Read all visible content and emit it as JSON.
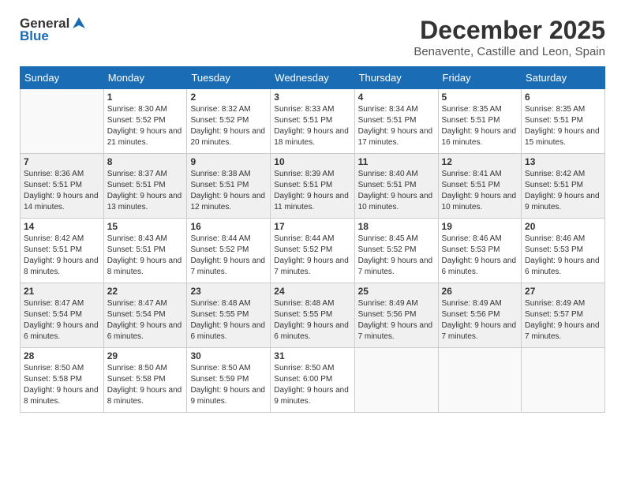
{
  "logo": {
    "general": "General",
    "blue": "Blue"
  },
  "header": {
    "month": "December 2025",
    "location": "Benavente, Castille and Leon, Spain"
  },
  "weekdays": [
    "Sunday",
    "Monday",
    "Tuesday",
    "Wednesday",
    "Thursday",
    "Friday",
    "Saturday"
  ],
  "weeks": [
    [
      {
        "day": "",
        "sunrise": "",
        "sunset": "",
        "daylight": ""
      },
      {
        "day": "1",
        "sunrise": "Sunrise: 8:30 AM",
        "sunset": "Sunset: 5:52 PM",
        "daylight": "Daylight: 9 hours and 21 minutes."
      },
      {
        "day": "2",
        "sunrise": "Sunrise: 8:32 AM",
        "sunset": "Sunset: 5:52 PM",
        "daylight": "Daylight: 9 hours and 20 minutes."
      },
      {
        "day": "3",
        "sunrise": "Sunrise: 8:33 AM",
        "sunset": "Sunset: 5:51 PM",
        "daylight": "Daylight: 9 hours and 18 minutes."
      },
      {
        "day": "4",
        "sunrise": "Sunrise: 8:34 AM",
        "sunset": "Sunset: 5:51 PM",
        "daylight": "Daylight: 9 hours and 17 minutes."
      },
      {
        "day": "5",
        "sunrise": "Sunrise: 8:35 AM",
        "sunset": "Sunset: 5:51 PM",
        "daylight": "Daylight: 9 hours and 16 minutes."
      },
      {
        "day": "6",
        "sunrise": "Sunrise: 8:35 AM",
        "sunset": "Sunset: 5:51 PM",
        "daylight": "Daylight: 9 hours and 15 minutes."
      }
    ],
    [
      {
        "day": "7",
        "sunrise": "Sunrise: 8:36 AM",
        "sunset": "Sunset: 5:51 PM",
        "daylight": "Daylight: 9 hours and 14 minutes."
      },
      {
        "day": "8",
        "sunrise": "Sunrise: 8:37 AM",
        "sunset": "Sunset: 5:51 PM",
        "daylight": "Daylight: 9 hours and 13 minutes."
      },
      {
        "day": "9",
        "sunrise": "Sunrise: 8:38 AM",
        "sunset": "Sunset: 5:51 PM",
        "daylight": "Daylight: 9 hours and 12 minutes."
      },
      {
        "day": "10",
        "sunrise": "Sunrise: 8:39 AM",
        "sunset": "Sunset: 5:51 PM",
        "daylight": "Daylight: 9 hours and 11 minutes."
      },
      {
        "day": "11",
        "sunrise": "Sunrise: 8:40 AM",
        "sunset": "Sunset: 5:51 PM",
        "daylight": "Daylight: 9 hours and 10 minutes."
      },
      {
        "day": "12",
        "sunrise": "Sunrise: 8:41 AM",
        "sunset": "Sunset: 5:51 PM",
        "daylight": "Daylight: 9 hours and 10 minutes."
      },
      {
        "day": "13",
        "sunrise": "Sunrise: 8:42 AM",
        "sunset": "Sunset: 5:51 PM",
        "daylight": "Daylight: 9 hours and 9 minutes."
      }
    ],
    [
      {
        "day": "14",
        "sunrise": "Sunrise: 8:42 AM",
        "sunset": "Sunset: 5:51 PM",
        "daylight": "Daylight: 9 hours and 8 minutes."
      },
      {
        "day": "15",
        "sunrise": "Sunrise: 8:43 AM",
        "sunset": "Sunset: 5:51 PM",
        "daylight": "Daylight: 9 hours and 8 minutes."
      },
      {
        "day": "16",
        "sunrise": "Sunrise: 8:44 AM",
        "sunset": "Sunset: 5:52 PM",
        "daylight": "Daylight: 9 hours and 7 minutes."
      },
      {
        "day": "17",
        "sunrise": "Sunrise: 8:44 AM",
        "sunset": "Sunset: 5:52 PM",
        "daylight": "Daylight: 9 hours and 7 minutes."
      },
      {
        "day": "18",
        "sunrise": "Sunrise: 8:45 AM",
        "sunset": "Sunset: 5:52 PM",
        "daylight": "Daylight: 9 hours and 7 minutes."
      },
      {
        "day": "19",
        "sunrise": "Sunrise: 8:46 AM",
        "sunset": "Sunset: 5:53 PM",
        "daylight": "Daylight: 9 hours and 6 minutes."
      },
      {
        "day": "20",
        "sunrise": "Sunrise: 8:46 AM",
        "sunset": "Sunset: 5:53 PM",
        "daylight": "Daylight: 9 hours and 6 minutes."
      }
    ],
    [
      {
        "day": "21",
        "sunrise": "Sunrise: 8:47 AM",
        "sunset": "Sunset: 5:54 PM",
        "daylight": "Daylight: 9 hours and 6 minutes."
      },
      {
        "day": "22",
        "sunrise": "Sunrise: 8:47 AM",
        "sunset": "Sunset: 5:54 PM",
        "daylight": "Daylight: 9 hours and 6 minutes."
      },
      {
        "day": "23",
        "sunrise": "Sunrise: 8:48 AM",
        "sunset": "Sunset: 5:55 PM",
        "daylight": "Daylight: 9 hours and 6 minutes."
      },
      {
        "day": "24",
        "sunrise": "Sunrise: 8:48 AM",
        "sunset": "Sunset: 5:55 PM",
        "daylight": "Daylight: 9 hours and 6 minutes."
      },
      {
        "day": "25",
        "sunrise": "Sunrise: 8:49 AM",
        "sunset": "Sunset: 5:56 PM",
        "daylight": "Daylight: 9 hours and 7 minutes."
      },
      {
        "day": "26",
        "sunrise": "Sunrise: 8:49 AM",
        "sunset": "Sunset: 5:56 PM",
        "daylight": "Daylight: 9 hours and 7 minutes."
      },
      {
        "day": "27",
        "sunrise": "Sunrise: 8:49 AM",
        "sunset": "Sunset: 5:57 PM",
        "daylight": "Daylight: 9 hours and 7 minutes."
      }
    ],
    [
      {
        "day": "28",
        "sunrise": "Sunrise: 8:50 AM",
        "sunset": "Sunset: 5:58 PM",
        "daylight": "Daylight: 9 hours and 8 minutes."
      },
      {
        "day": "29",
        "sunrise": "Sunrise: 8:50 AM",
        "sunset": "Sunset: 5:58 PM",
        "daylight": "Daylight: 9 hours and 8 minutes."
      },
      {
        "day": "30",
        "sunrise": "Sunrise: 8:50 AM",
        "sunset": "Sunset: 5:59 PM",
        "daylight": "Daylight: 9 hours and 9 minutes."
      },
      {
        "day": "31",
        "sunrise": "Sunrise: 8:50 AM",
        "sunset": "Sunset: 6:00 PM",
        "daylight": "Daylight: 9 hours and 9 minutes."
      },
      {
        "day": "",
        "sunrise": "",
        "sunset": "",
        "daylight": ""
      },
      {
        "day": "",
        "sunrise": "",
        "sunset": "",
        "daylight": ""
      },
      {
        "day": "",
        "sunrise": "",
        "sunset": "",
        "daylight": ""
      }
    ]
  ]
}
